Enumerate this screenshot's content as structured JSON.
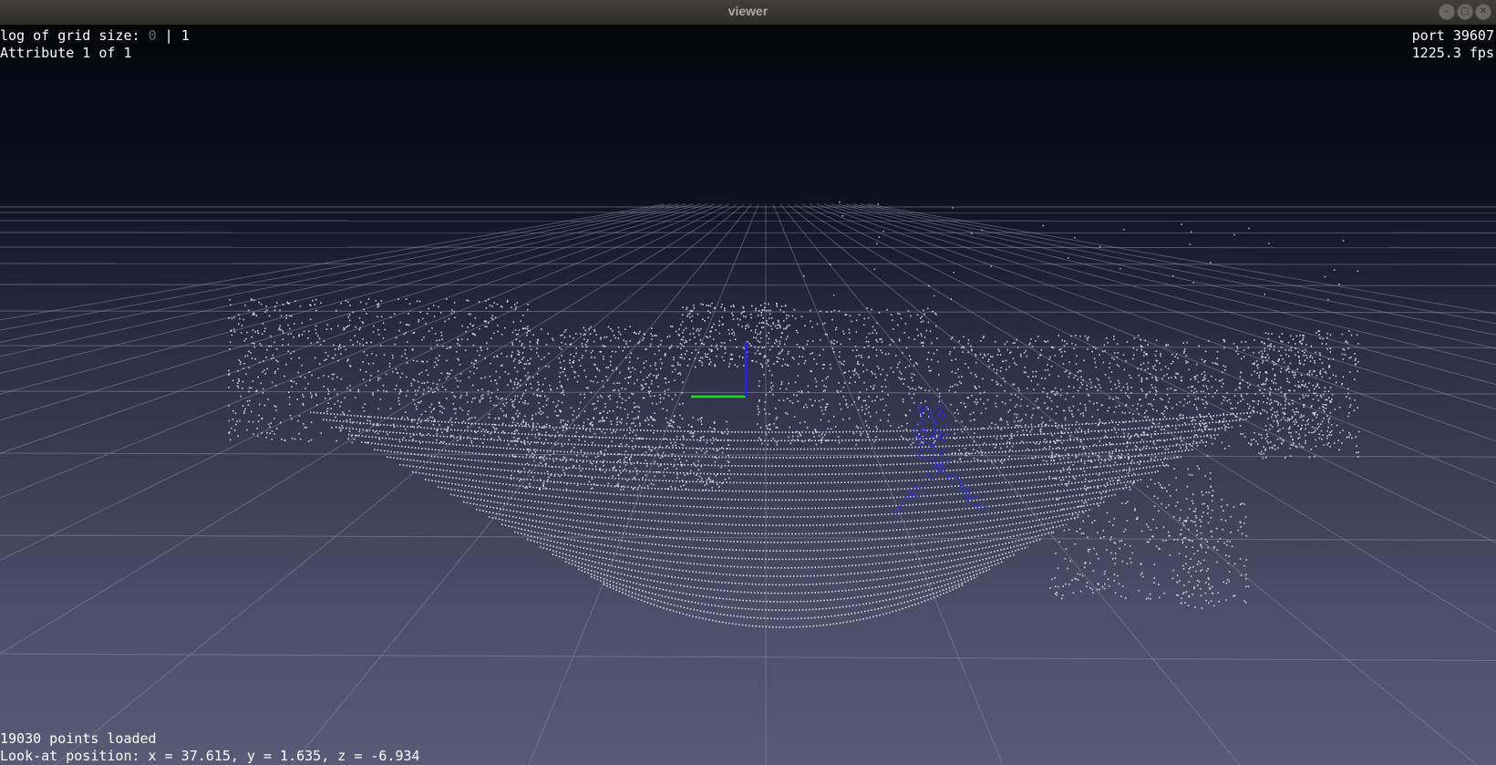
{
  "window": {
    "title": "viewer",
    "controls": {
      "minimize": "–",
      "maximize": "□",
      "close": "✕"
    }
  },
  "hud": {
    "grid_label": "log of grid size: ",
    "grid_value_dim": "0",
    "grid_separator": " | ",
    "grid_value": "1",
    "attribute": "Attribute 1 of 1",
    "port": "port 39607",
    "fps": "1225.3 fps",
    "points_loaded": "19030 points loaded",
    "look_at": "Look-at position: x = 37.615, y = 1.635, z = -6.934"
  },
  "scene": {
    "point_color": "#e6e6ec",
    "highlight_color": "#3030d0",
    "axis_colors": {
      "x": "#22dd22",
      "z": "#2222ff"
    },
    "grid_color": "#8a8ca0"
  }
}
